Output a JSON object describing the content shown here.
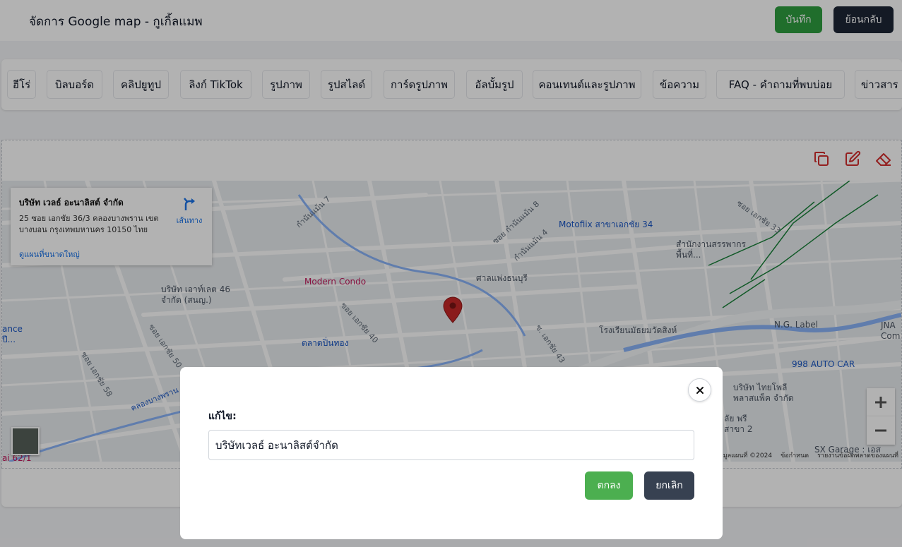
{
  "header": {
    "title": "จัดการ Google map - กูเกิ้ลแมพ",
    "save_label": "บันทึก",
    "back_label": "ย้อนกลับ"
  },
  "tabs": [
    {
      "label": "ฮีโร่"
    },
    {
      "label": "บิลบอร์ด"
    },
    {
      "label": "คลิปยูทูป"
    },
    {
      "label": "ลิงก์ TikTok"
    },
    {
      "label": "รูปภาพ"
    },
    {
      "label": "รูปสไลด์"
    },
    {
      "label": "การ์ดรูปภาพ"
    },
    {
      "label": "อัลบั้มรูป"
    },
    {
      "label": "คอนเทนต์และรูปภาพ"
    },
    {
      "label": "ข้อความ"
    },
    {
      "label": "FAQ - คำถามที่พบบ่อย"
    },
    {
      "label": "ข่าวสาร"
    }
  ],
  "toolbar": {
    "icons": [
      "copy-icon",
      "edit-icon",
      "eraser-icon"
    ]
  },
  "map": {
    "info_card": {
      "name": "บริษัท เวลธ์ อะนาลิสต์ จำกัด",
      "address": "25 ซอย เอกชัย 36/3 คลองบางพราน เขตบางบอน กรุงเทพมหานคร 10150 ไทย",
      "larger_map_link": "ดูแผนที่ขนาดใหญ่",
      "directions_label": "เส้นทาง"
    },
    "places": {
      "motofix": "Motofiix สาขาเอกชัย 34",
      "revenue_office": "สำนักงานสรรพากรพื้นที่...",
      "modern_condo": "Modern Condo",
      "sala": "ศาลแพ่งธนบุรี",
      "company_left": "บริษัท เอาท์เลต 46 จำกัด (สนญ.)",
      "school": "โรงเรียนมัธยมวัดสิงห์",
      "ng_label": "N.G. Label",
      "jna": "JNA Com",
      "market": "ตลาดปิ่นทอง",
      "auto_car": "998 AUTO CAR",
      "thai_poly": "บริษัท ไทยโพลี พลาสแพ็ค จำกัด",
      "sx_garage": "SX Garage : เอส",
      "ance": "ance ปี...",
      "prei": "ลัย พรี สาขา 2",
      "bottom_left": "ai 62/1",
      "street_7": "กำนันแม้น 7",
      "street_8": "ซอย กำนันแม้น 8",
      "street_4": "กำนันแม้น 4",
      "street_33": "ซอย เอกชัย 33",
      "street_40": "ซอย เอกชัย 40",
      "street_43": "ซ. เอกชัย 43",
      "street_50": "ซอย เอกชัย 50",
      "street_58": "ซอย เอกชัย 58",
      "canal": "คลองบางพราน"
    },
    "attribution": {
      "data": "ข้อมูลแผนที่ ©2024",
      "terms": "ข้อกำหนด",
      "report": "รายงานข้อผิดพลาดของแผนที่"
    }
  },
  "modal": {
    "label": "แก้ไข:",
    "input_value": "บริษัทเวลธ์ อะนาลิสต์จำกัด",
    "ok_label": "ตกลง",
    "cancel_label": "ยกเลิก"
  },
  "colors": {
    "save": "#2e9e40",
    "back": "#1e2636",
    "ok": "#4caf50",
    "cancel": "#374151",
    "tool_icons": "#d32f2f",
    "marker": "#c62828"
  }
}
